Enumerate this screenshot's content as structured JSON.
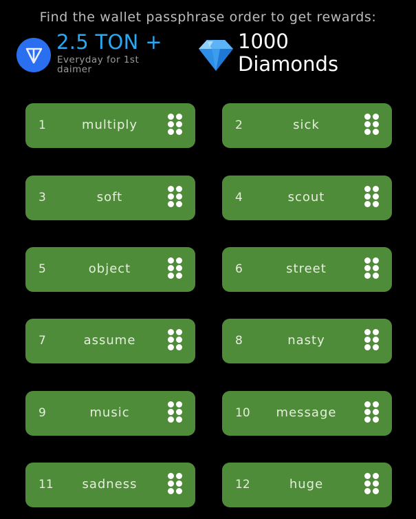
{
  "header": {
    "title": "Find the wallet passphrase order to get rewards:"
  },
  "rewards": {
    "ton": {
      "icon": "ton-logo-icon",
      "amount": "2.5 TON +",
      "subtitle": "Everyday for 1st daimer",
      "color": "#2aa8f0"
    },
    "diamonds": {
      "icon": "diamond-icon",
      "text": "1000 Diamonds"
    }
  },
  "card_color": "#4e8c3a",
  "words": [
    {
      "number": "1",
      "word": "multiply"
    },
    {
      "number": "2",
      "word": "sick"
    },
    {
      "number": "3",
      "word": "soft"
    },
    {
      "number": "4",
      "word": "scout"
    },
    {
      "number": "5",
      "word": "object"
    },
    {
      "number": "6",
      "word": "street"
    },
    {
      "number": "7",
      "word": "assume"
    },
    {
      "number": "8",
      "word": "nasty"
    },
    {
      "number": "9",
      "word": "music"
    },
    {
      "number": "10",
      "word": "message"
    },
    {
      "number": "11",
      "word": "sadness"
    },
    {
      "number": "12",
      "word": "huge"
    }
  ]
}
